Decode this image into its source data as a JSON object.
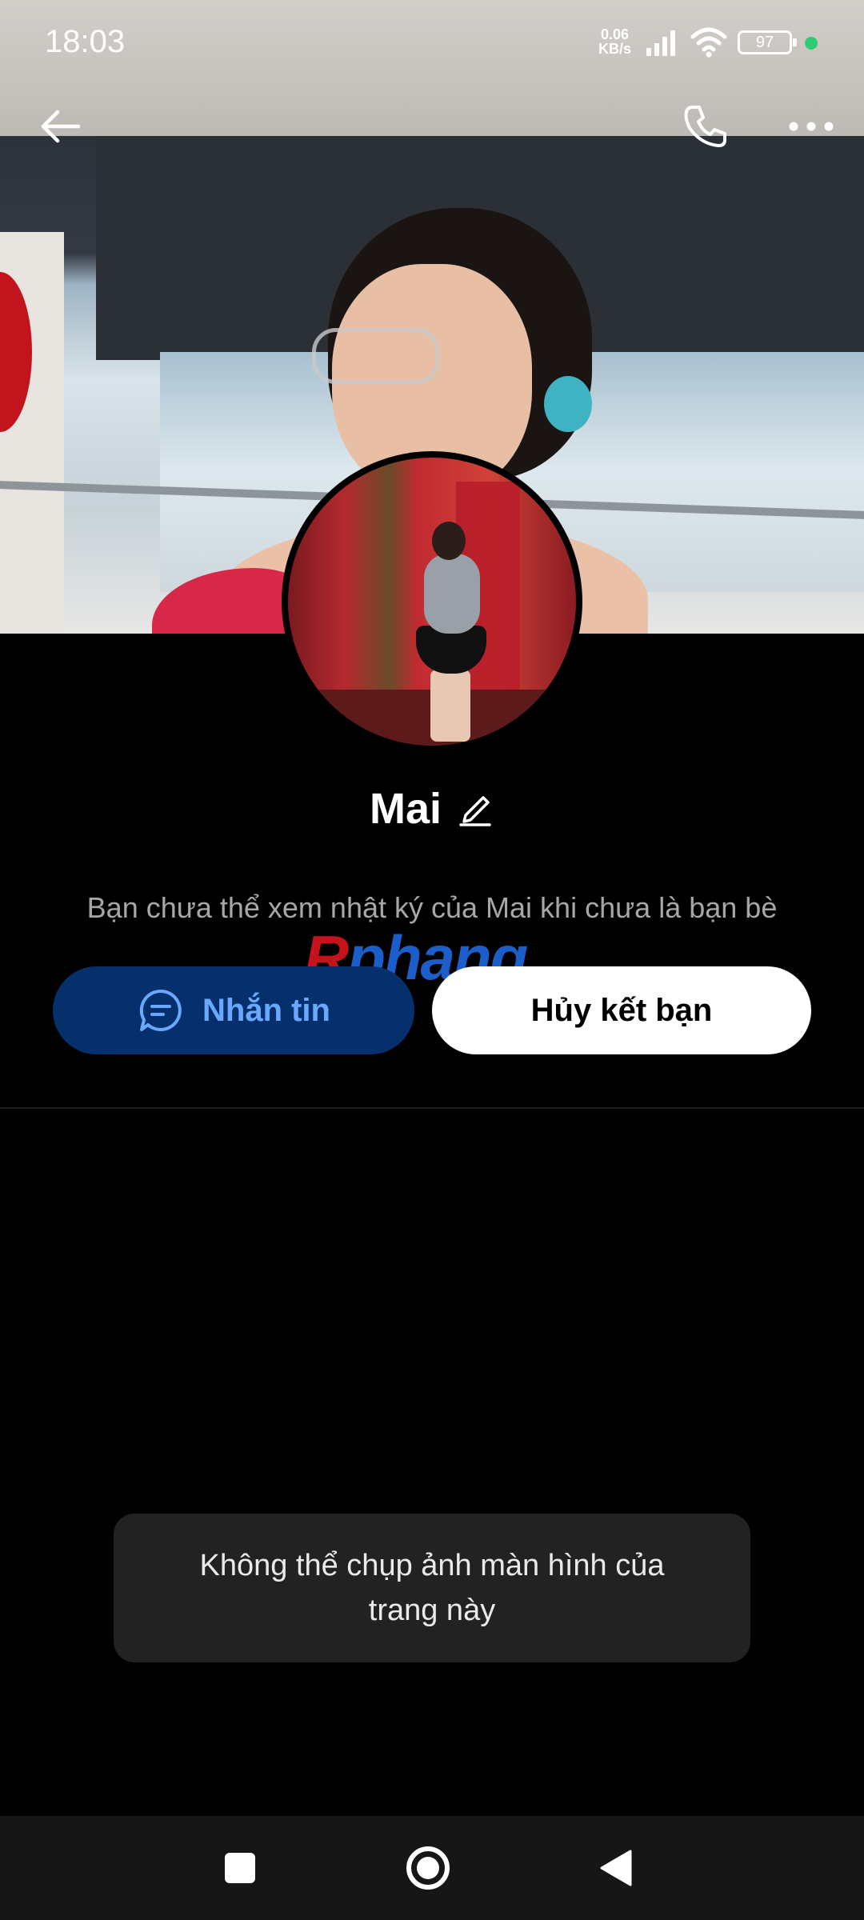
{
  "status_bar": {
    "time": "18:03",
    "net_speed_value": "0.06",
    "net_speed_unit": "KB/s",
    "battery": "97",
    "charge_indicator_color": "#2ecc71"
  },
  "top_bar": {
    "back_icon": "arrow-left-icon",
    "call_icon": "phone-icon",
    "more_icon": "more-horizontal-icon"
  },
  "profile": {
    "name": "Mai",
    "edit_icon": "pencil-icon",
    "info_text": "Bạn chưa thể xem nhật ký của Mai khi chưa là bạn bè"
  },
  "watermark": {
    "part1": "R",
    "part2": "phang"
  },
  "actions": {
    "message_label": "Nhắn tin",
    "message_icon": "chat-bubble-icon",
    "unfriend_label": "Hủy kết bạn"
  },
  "toast": {
    "text": "Không thể chụp ảnh màn hình của trang này"
  },
  "nav": {
    "recents_icon": "square-icon",
    "home_icon": "circle-icon",
    "back_icon": "triangle-back-icon"
  },
  "colors": {
    "message_button_bg": "#06306b",
    "message_button_text": "#6aa8ff",
    "background": "#000000"
  }
}
